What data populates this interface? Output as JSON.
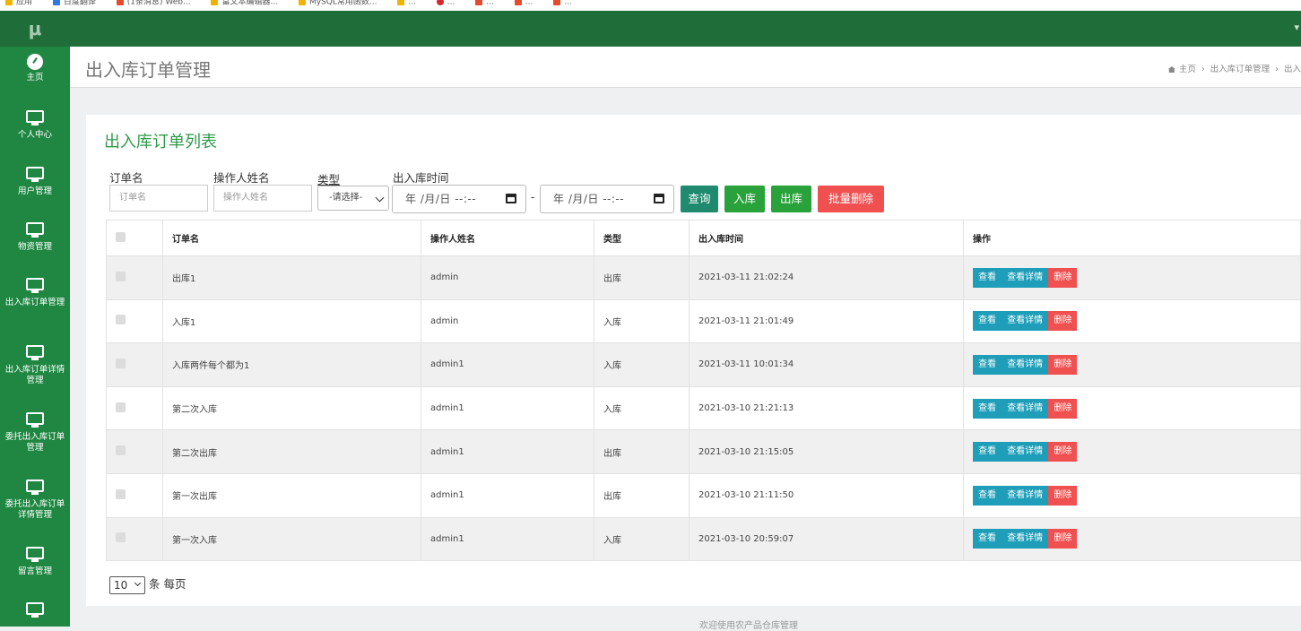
{
  "sidebar": {
    "logo": "μ",
    "items": [
      {
        "label": "主页",
        "icon": "dashboard-icon"
      },
      {
        "label": "个人中心",
        "icon": "monitor-icon"
      },
      {
        "label": "用户管理",
        "icon": "monitor-icon"
      },
      {
        "label": "物资管理",
        "icon": "monitor-icon"
      },
      {
        "label": "出入库订单管理",
        "icon": "monitor-icon"
      },
      {
        "label": "出入库订单详情管理",
        "icon": "monitor-icon"
      },
      {
        "label": "委托出入库订单管理",
        "icon": "monitor-icon"
      },
      {
        "label": "委托出入库订单详情管理",
        "icon": "monitor-icon"
      },
      {
        "label": "留言管理",
        "icon": "monitor-icon"
      },
      {
        "label": "",
        "icon": "monitor-icon"
      }
    ]
  },
  "header": {
    "title": "出入库订单管理",
    "breadcrumb": [
      "主页",
      "出入库订单管理",
      "出入"
    ]
  },
  "panel": {
    "title": "出入库订单列表"
  },
  "filters": {
    "order_name_label": "订单名",
    "order_name_placeholder": "订单名",
    "operator_label": "操作人姓名",
    "operator_placeholder": "操作人姓名",
    "type_label": "类型",
    "type_selected": "-请选择-",
    "time_label": "出入库时间",
    "date_placeholder": "年 /月/日 --:--",
    "date_separator": "-",
    "search_btn": "查询",
    "in_btn": "入库",
    "out_btn": "出库",
    "batch_delete_btn": "批量删除"
  },
  "table": {
    "headers": [
      "订单名",
      "操作人姓名",
      "类型",
      "出入库时间",
      "操作"
    ],
    "rows": [
      {
        "name": "出库1",
        "operator": "admin",
        "type": "出库",
        "time": "2021-03-11 21:02:24"
      },
      {
        "name": "入库1",
        "operator": "admin",
        "type": "入库",
        "time": "2021-03-11 21:01:49"
      },
      {
        "name": "入库两件每个都为1",
        "operator": "admin1",
        "type": "入库",
        "time": "2021-03-11 10:01:34"
      },
      {
        "name": "第二次入库",
        "operator": "admin1",
        "type": "入库",
        "time": "2021-03-10 21:21:13"
      },
      {
        "name": "第二次出库",
        "operator": "admin1",
        "type": "出库",
        "time": "2021-03-10 21:15:05"
      },
      {
        "name": "第一次出库",
        "operator": "admin1",
        "type": "出库",
        "time": "2021-03-10 21:11:50"
      },
      {
        "name": "第一次入库",
        "operator": "admin1",
        "type": "入库",
        "time": "2021-03-10 20:59:07"
      }
    ],
    "actions": {
      "view": "查看",
      "detail": "查看详情",
      "delete": "删除"
    }
  },
  "pager": {
    "page_size": "10",
    "suffix": "条 每页"
  },
  "footer": "欢迎使用农产品仓库管理"
}
